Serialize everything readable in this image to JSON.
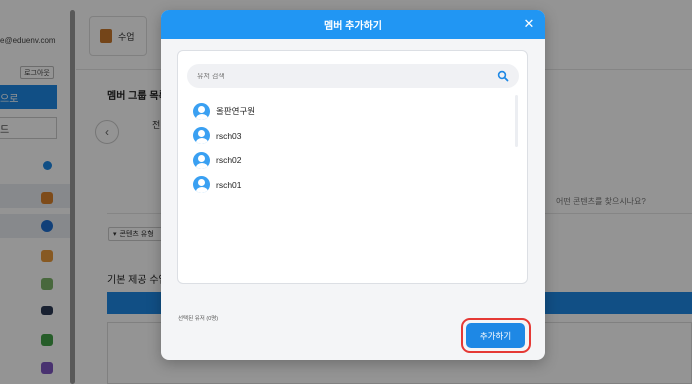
{
  "background": {
    "sidebar": {
      "email": "e@eduenv.com",
      "logout_label": "로그아웃",
      "blue_item_label": "으로",
      "outline_item_label": "드"
    },
    "topbar": {
      "class_tab_label": "수업"
    },
    "main": {
      "group_title": "멤버 그룹 목록",
      "snippet": "전",
      "search_hint": "어떤 콘텐츠를 찾으시나요?",
      "filter_label": "콘텐츠 유형",
      "basic_title": "기본 제공 수업"
    }
  },
  "modal": {
    "title": "멤버 추가하기",
    "close_icon": "close-icon",
    "search": {
      "placeholder": "유저 검색",
      "value": ""
    },
    "members": [
      {
        "name": "올판연구원"
      },
      {
        "name": "rsch03"
      },
      {
        "name": "rsch02"
      },
      {
        "name": "rsch01"
      }
    ],
    "selected_count": "선택된 유저 (0명)",
    "add_button_label": "추가하기"
  },
  "colors": {
    "accent": "#2196f3",
    "button": "#1e88e5",
    "highlight": "#e53935"
  }
}
